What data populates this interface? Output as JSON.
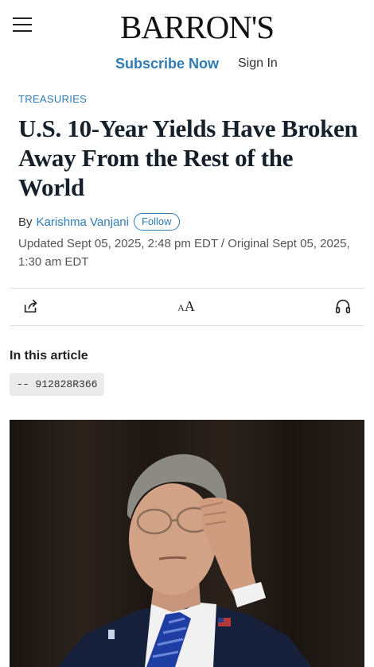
{
  "header": {
    "logo": "BARRON'S",
    "subscribe_label": "Subscribe Now",
    "signin_label": "Sign In"
  },
  "article": {
    "kicker": "TREASURIES",
    "headline": "U.S. 10-Year Yields Have Broken Away From the Rest of the World",
    "by_prefix": "By",
    "author": "Karishma Vanjani",
    "follow_label": "Follow",
    "dates": "Updated Sept 05, 2025, 2:48 pm EDT / Original Sept 05, 2025, 1:30 am EDT"
  },
  "toolbar": {
    "share_icon": "share-icon",
    "text_size_icon": "text-size-icon",
    "text_size_glyph_small": "A",
    "text_size_glyph_large": "A",
    "listen_icon": "headphones-icon"
  },
  "in_article": {
    "heading": "In this article",
    "ticker": "-- 912828R366"
  },
  "colors": {
    "accent": "#2f7bb5",
    "headline": "#15202b",
    "divider": "#e2e2e2"
  }
}
